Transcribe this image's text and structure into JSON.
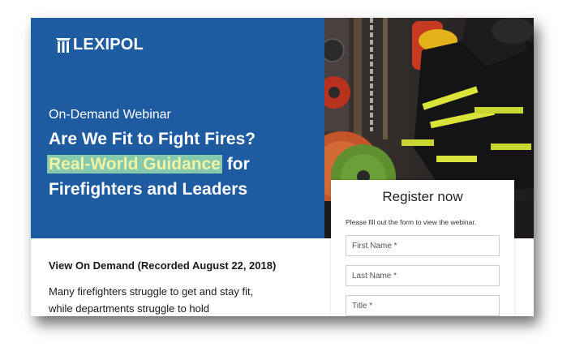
{
  "brand": {
    "name": "LEXIPOL"
  },
  "hero": {
    "eyebrow": "On-Demand Webinar",
    "title_line1": "Are We Fit to Fight Fires?",
    "title_highlight": "Real-World Guidance",
    "title_after_highlight": " for",
    "title_line3": "Firefighters and Leaders",
    "background_color": "#1e5ba1",
    "highlight_color": "#87c9ad"
  },
  "body": {
    "subheading": "View On Demand (Recorded August 22, 2018)",
    "paragraph": "Many firefighters struggle to get and stay fit, while departments struggle to hold firefighters"
  },
  "form": {
    "title": "Register now",
    "description": "Please fill out the form to view the webinar.",
    "fields": [
      {
        "placeholder": "First Name *"
      },
      {
        "placeholder": "Last Name *"
      },
      {
        "placeholder": "Title *"
      }
    ]
  }
}
